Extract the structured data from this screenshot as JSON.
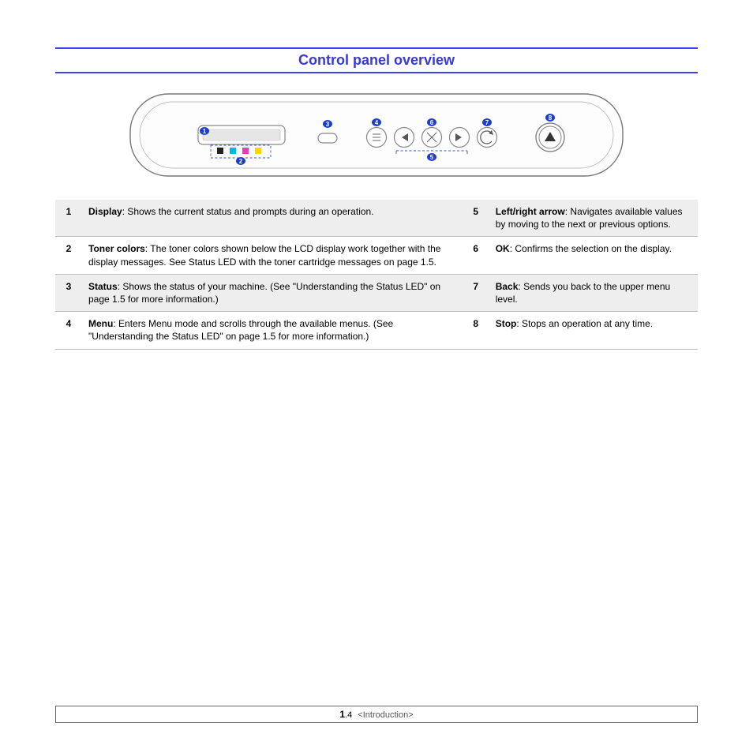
{
  "title": "Control panel overview",
  "callouts": [
    "1",
    "2",
    "3",
    "4",
    "5",
    "6",
    "7",
    "8"
  ],
  "table": {
    "left": [
      {
        "num": "1",
        "term": "Display",
        "rest": ": Shows the current status and prompts during an operation."
      },
      {
        "num": "2",
        "term": "Toner colors",
        "rest": ": The toner colors shown below the LCD display work together with the display messages. See Status LED with the toner cartridge messages on page 1.5."
      },
      {
        "num": "3",
        "term": "Status",
        "rest": ": Shows the status of your machine. (See \"Understanding the Status LED\" on page 1.5 for more information.)"
      },
      {
        "num": "4",
        "term": "Menu",
        "rest": ": Enters Menu mode and scrolls through the available menus. (See \"Understanding the Status LED\" on page 1.5 for more information.)"
      }
    ],
    "right": [
      {
        "num": "5",
        "term": "Left/right arrow",
        "rest": ": Navigates available values by moving to the next or previous options."
      },
      {
        "num": "6",
        "term": "OK",
        "rest": ": Confirms the selection on the display."
      },
      {
        "num": "7",
        "term": "Back",
        "rest": ": Sends you back to the upper menu level."
      },
      {
        "num": "8",
        "term": "Stop",
        "rest": ": Stops an operation at any time."
      }
    ]
  },
  "footer": {
    "page_major": "1",
    "page_minor": ".4",
    "section": "<Introduction>"
  }
}
